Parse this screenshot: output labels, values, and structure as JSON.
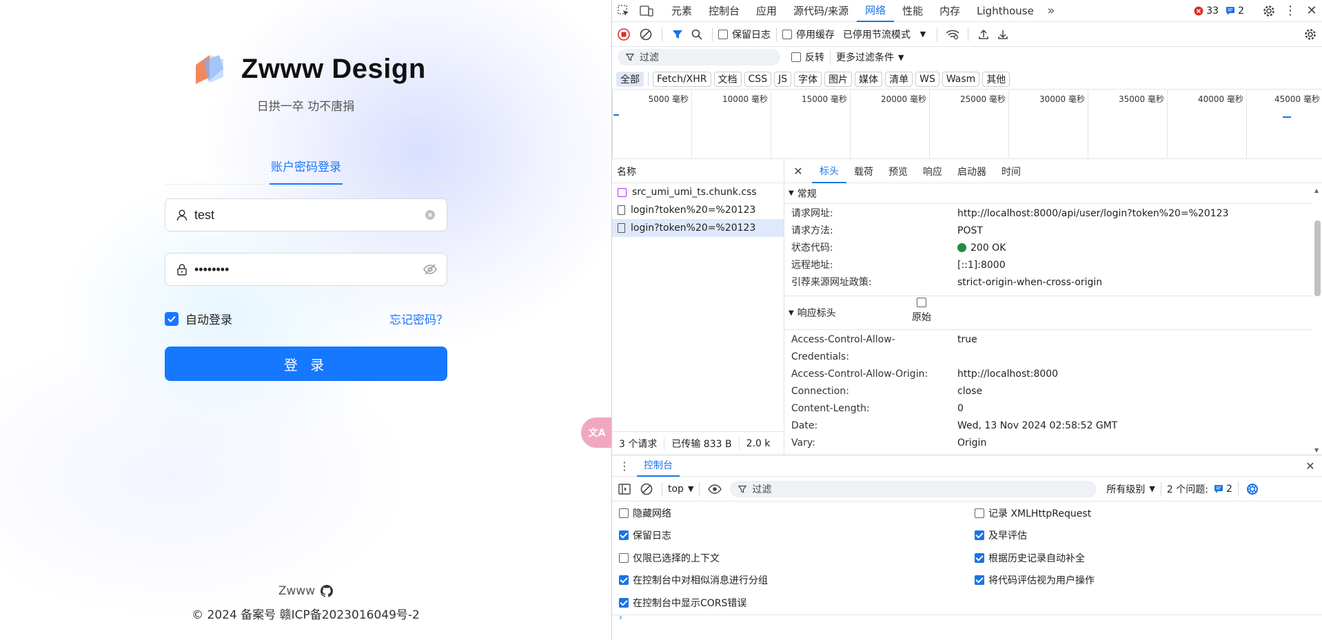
{
  "login": {
    "brand_name": "Zwww Design",
    "slogan": "日拱一卒 功不唐捐",
    "tab_label": "账户密码登录",
    "username_value": "test",
    "password_masked": "••••••••",
    "auto_login_label": "自动登录",
    "auto_login_checked": true,
    "forgot_label": "忘记密码？",
    "login_button": "登 录",
    "footer_name": "Zwww",
    "footer_copyright": "© 2024 备案号 赣ICP备2023016049号-2",
    "translate_label": "文A"
  },
  "devtools": {
    "main_tabs": [
      "元素",
      "控制台",
      "应用",
      "源代码/来源",
      "网络",
      "性能",
      "内存",
      "Lighthouse"
    ],
    "active_tab": "网络",
    "error_count": "33",
    "message_count": "2",
    "toolbar": {
      "preserve_log": "保留日志",
      "disable_cache": "停用缓存",
      "throttling": "已停用节流模式"
    },
    "filter": {
      "placeholder": "过滤",
      "invert": "反转",
      "more_filters": "更多过滤条件"
    },
    "type_filters": [
      "全部",
      "Fetch/XHR",
      "文档",
      "CSS",
      "JS",
      "字体",
      "图片",
      "媒体",
      "清单",
      "WS",
      "Wasm",
      "其他"
    ],
    "timeline_ticks": [
      "5000 毫秒",
      "10000 毫秒",
      "15000 毫秒",
      "20000 毫秒",
      "25000 毫秒",
      "30000 毫秒",
      "35000 毫秒",
      "40000 毫秒",
      "45000 毫秒"
    ],
    "list_header": "名称",
    "requests": [
      "src_umi_umi_ts.chunk.css",
      "login?token%20=%20123",
      "login?token%20=%20123"
    ],
    "status": {
      "requests": "3 个请求",
      "transferred": "已传输 833 B",
      "resources": "2.0 k"
    },
    "detail_tabs": [
      "标头",
      "载荷",
      "预览",
      "响应",
      "启动器",
      "时间"
    ],
    "general_section": "常规",
    "general": [
      {
        "k": "请求网址:",
        "v": "http://localhost:8000/api/user/login?token%20=%20123"
      },
      {
        "k": "请求方法:",
        "v": "POST"
      },
      {
        "k": "状态代码:",
        "v": "200 OK"
      },
      {
        "k": "远程地址:",
        "v": "[::1]:8000"
      },
      {
        "k": "引荐来源网址政策:",
        "v": "strict-origin-when-cross-origin"
      }
    ],
    "response_section": "响应标头",
    "raw_label": "原始",
    "response_headers": [
      {
        "k": "Access-Control-Allow-Credentials:",
        "v": "true"
      },
      {
        "k": "Access-Control-Allow-Origin:",
        "v": "http://localhost:8000"
      },
      {
        "k": "Connection:",
        "v": "close"
      },
      {
        "k": "Content-Length:",
        "v": "0"
      },
      {
        "k": "Date:",
        "v": "Wed, 13 Nov 2024 02:58:52 GMT"
      },
      {
        "k": "Vary:",
        "v": "Origin"
      }
    ],
    "drawer_tab": "控制台",
    "console": {
      "context": "top",
      "filter_placeholder": "过滤",
      "levels": "所有级别",
      "issues_label": "2 个问题:",
      "issues_count": "2"
    },
    "settings_left": [
      {
        "label": "隐藏网络",
        "checked": false
      },
      {
        "label": "保留日志",
        "checked": true
      },
      {
        "label": "仅限已选择的上下文",
        "checked": false
      },
      {
        "label": "在控制台中对相似消息进行分组",
        "checked": true
      },
      {
        "label": "在控制台中显示CORS错误",
        "checked": true
      }
    ],
    "settings_right": [
      {
        "label": "记录 XMLHttpRequest",
        "checked": false
      },
      {
        "label": "及早评估",
        "checked": true
      },
      {
        "label": "根据历史记录自动补全",
        "checked": true
      },
      {
        "label": "将代码评估视为用户操作",
        "checked": true
      }
    ]
  },
  "colors": {
    "primary": "#1677ff",
    "devtools_accent": "#1a73e8",
    "error": "#d93025",
    "success": "#1e8e3e"
  }
}
